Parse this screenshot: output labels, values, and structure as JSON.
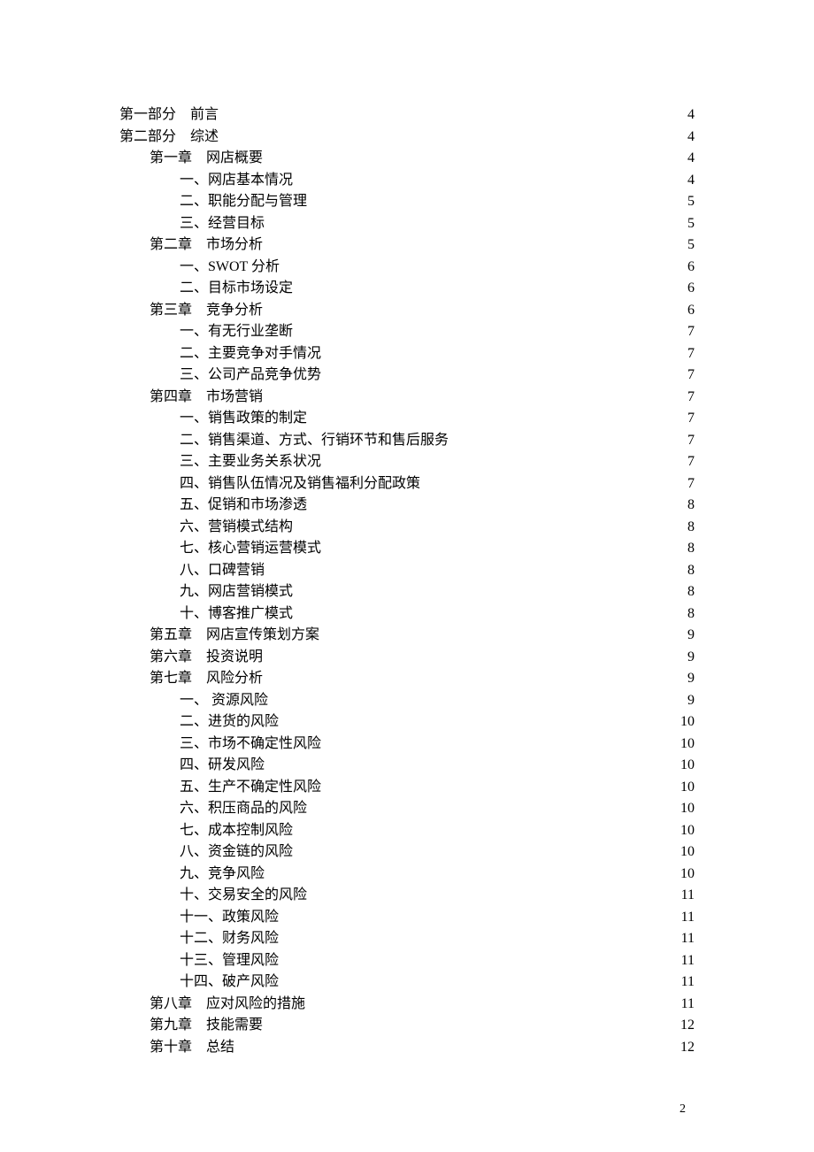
{
  "toc": [
    {
      "label": "第一部分　前言",
      "page": "4",
      "indent": 0
    },
    {
      "label": "第二部分　综述",
      "page": "4",
      "indent": 0
    },
    {
      "label": "第一章　网店概要",
      "page": "4",
      "indent": 1
    },
    {
      "label": "一、网店基本情况",
      "page": "4",
      "indent": 2
    },
    {
      "label": "二、职能分配与管理",
      "page": "5",
      "indent": 2
    },
    {
      "label": "三、经营目标",
      "page": "5",
      "indent": 2
    },
    {
      "label": "第二章　市场分析",
      "page": "5",
      "indent": 1
    },
    {
      "label": "一、SWOT 分析",
      "page": "6",
      "indent": 2
    },
    {
      "label": "二、目标市场设定",
      "page": "6",
      "indent": 2
    },
    {
      "label": "第三章　竞争分析",
      "page": "6",
      "indent": 1
    },
    {
      "label": "一、有无行业垄断",
      "page": "7",
      "indent": 2
    },
    {
      "label": "二、主要竞争对手情况",
      "page": "7",
      "indent": 2
    },
    {
      "label": "三、公司产品竞争优势",
      "page": "7",
      "indent": 2
    },
    {
      "label": "第四章　市场营销",
      "page": "7",
      "indent": 1
    },
    {
      "label": "一、销售政策的制定",
      "page": "7",
      "indent": 2
    },
    {
      "label": "二、销售渠道、方式、行销环节和售后服务",
      "page": "7",
      "indent": 2
    },
    {
      "label": "三、主要业务关系状况",
      "page": "7",
      "indent": 2
    },
    {
      "label": "四、销售队伍情况及销售福利分配政策",
      "page": "7",
      "indent": 2
    },
    {
      "label": "五、促销和市场渗透",
      "page": "8",
      "indent": 2
    },
    {
      "label": "六、营销模式结构",
      "page": "8",
      "indent": 2
    },
    {
      "label": "七、核心营销运营模式",
      "page": "8",
      "indent": 2
    },
    {
      "label": "八、口碑营销",
      "page": "8",
      "indent": 2
    },
    {
      "label": "九、网店营销模式",
      "page": "8",
      "indent": 2
    },
    {
      "label": "十、博客推广模式",
      "page": "8",
      "indent": 2
    },
    {
      "label": "第五章　网店宣传策划方案",
      "page": "9",
      "indent": 1
    },
    {
      "label": "第六章　投资说明",
      "page": "9",
      "indent": 1
    },
    {
      "label": "第七章　风险分析",
      "page": "9",
      "indent": 1
    },
    {
      "label": "一、 资源风险",
      "page": "9",
      "indent": 2
    },
    {
      "label": "二、进货的风险",
      "page": "10",
      "indent": 2
    },
    {
      "label": "三、市场不确定性风险",
      "page": "10",
      "indent": 2
    },
    {
      "label": "四、研发风险",
      "page": "10",
      "indent": 2
    },
    {
      "label": "五、生产不确定性风险",
      "page": "10",
      "indent": 2
    },
    {
      "label": "六、积压商品的风险",
      "page": "10",
      "indent": 2
    },
    {
      "label": "七、成本控制风险",
      "page": "10",
      "indent": 2
    },
    {
      "label": "八、资金链的风险",
      "page": "10",
      "indent": 2
    },
    {
      "label": "九、竞争风险",
      "page": "10",
      "indent": 2
    },
    {
      "label": "十、交易安全的风险",
      "page": "11",
      "indent": 2
    },
    {
      "label": "十一、政策风险",
      "page": "11",
      "indent": 2
    },
    {
      "label": "十二、财务风险",
      "page": "11",
      "indent": 2
    },
    {
      "label": "十三、管理风险",
      "page": "11",
      "indent": 2,
      "shift": true
    },
    {
      "label": "十四、破产风险",
      "page": "11",
      "indent": 2,
      "shift": true
    },
    {
      "label": "第八章　应对风险的措施",
      "page": "11",
      "indent": 1,
      "shift": true
    },
    {
      "label": "第九章　技能需要",
      "page": "12",
      "indent": 1,
      "shift": true
    },
    {
      "label": "第十章　总结",
      "page": "12",
      "indent": 1,
      "shift": true
    }
  ],
  "page_number": "2"
}
